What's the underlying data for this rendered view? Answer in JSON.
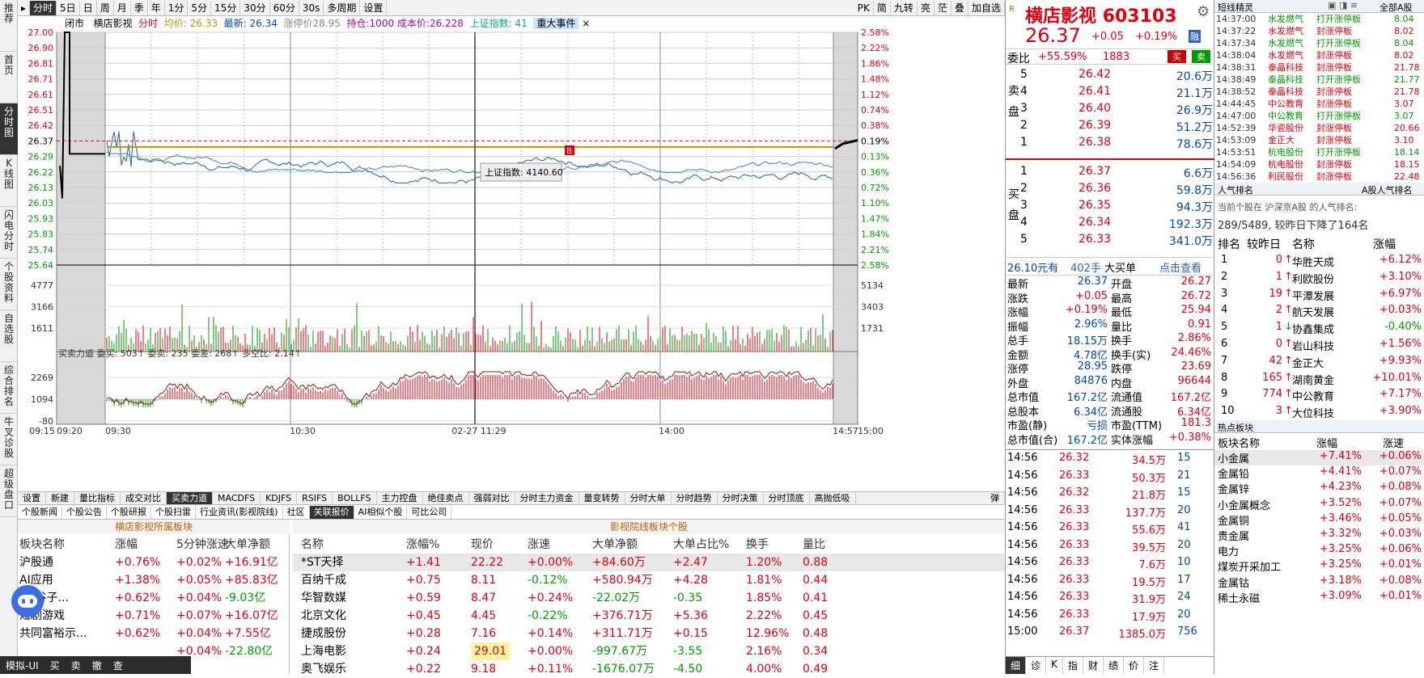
{
  "left_nav": [
    "推荐",
    "首页",
    "分时图",
    "K线图",
    "闪电分时",
    "个股资料",
    "自选股",
    "综合排名",
    "牛叉诊股",
    "超级盘口"
  ],
  "top_tabs": [
    "分时",
    "5日",
    "日",
    "周",
    "月",
    "季",
    "年",
    "1分",
    "5分",
    "15分",
    "30分",
    "60分",
    "30s",
    "多周期",
    "设置"
  ],
  "top_right_tabs": [
    "PK",
    "简",
    "九转",
    "亮",
    "茫",
    "叠",
    "加自选"
  ],
  "info_bar": {
    "status": "闭市",
    "name": "横店影视",
    "ftitle": "分时",
    "avg": "均价: 26.33",
    "latest": "最新: 26.34",
    "limitup": "涨停价28.95",
    "hold": "持仓:1000 成本价:26.228",
    "index": "上证指数: 41",
    "event": "重大事件"
  },
  "price_axis_left": [
    "27.00",
    "26.90",
    "26.81",
    "26.71",
    "26.61",
    "26.51",
    "26.42",
    "26.37",
    "26.29",
    "26.22",
    "26.13",
    "26.03",
    "25.93",
    "25.83",
    "25.74",
    "25.64"
  ],
  "pct_axis_right": [
    "2.58%",
    "2.22%",
    "1.86%",
    "1.48%",
    "1.12%",
    "0.74%",
    "0.38%",
    "0.19%",
    "0.13%",
    "0.36%",
    "0.72%",
    "1.10%",
    "1.47%",
    "1.84%",
    "2.21%",
    "2.58%"
  ],
  "vol_axis_left": [
    "4777",
    "3166",
    "1611"
  ],
  "vol_axis_right": [
    "5134",
    "3403",
    "1731"
  ],
  "ind_axis_left": [
    "2269",
    "1094",
    "-80"
  ],
  "ind_title": "买卖力道 委买: 503↑ 委卖: 235 委差: 268↑ 多空比: 2.14↑",
  "time_axis": [
    "09:15",
    "09:20",
    "09:30",
    "10:30",
    "02-27 11:29",
    "14:00",
    "14:57",
    "15:00"
  ],
  "tooltip": "上证指数: 4140.60",
  "toolbar2": [
    "设置",
    "新建",
    "量比指标",
    "成交对比",
    "买卖力道",
    "MACDFS",
    "KDJFS",
    "RSIFS",
    "BOLLFS",
    "主力控盘",
    "绝佳卖点",
    "强弱对比",
    "分时主力资金",
    "量变转势",
    "分时大单",
    "分时趋势",
    "分时决策",
    "分时顶底",
    "高抛低吸"
  ],
  "toolbar2_right": "弹",
  "tabs3": [
    "个股新闻",
    "个股公告",
    "个股研报",
    "个股扫雷",
    "行业资讯(影视院线)",
    "社区",
    "关联报价",
    "AI相似个股",
    "可比公司"
  ],
  "sector_panel": {
    "title": "横店影视所属板块",
    "headers": [
      "板块名称",
      "涨幅",
      "5分钟涨速",
      "大单净额"
    ],
    "rows": [
      [
        "沪股通",
        "+0.76%",
        "+0.02%",
        "+16.91亿"
      ],
      [
        "AI应用",
        "+1.38%",
        "+0.05%",
        "+85.83亿"
      ],
      [
        "济(谷子...",
        "+0.62%",
        "+0.04%",
        "-9.03亿"
      ],
      [
        "短剧游戏",
        "+0.71%",
        "+0.07%",
        "+16.07亿"
      ],
      [
        "共同富裕示...",
        "+0.62%",
        "+0.04%",
        "+7.55亿"
      ],
      [
        "",
        "",
        "+0.04%",
        "-22.80亿"
      ]
    ]
  },
  "stock_panel": {
    "title": "影视院线板块个股",
    "headers": [
      "名称",
      "涨幅%",
      "现价",
      "涨速",
      "大单净额",
      "大单占比%",
      "换手",
      "量比"
    ],
    "rows": [
      [
        "*ST天择",
        "+1.41",
        "22.22",
        "+0.00%",
        "+84.60万",
        "+2.47",
        "1.20%",
        "0.88"
      ],
      [
        "百纳千成",
        "+0.75",
        "8.11",
        "-0.12%",
        "+580.94万",
        "+4.28",
        "1.81%",
        "0.44"
      ],
      [
        "华智数媒",
        "+0.59",
        "8.47",
        "+0.24%",
        "-22.02万",
        "-0.35",
        "1.85%",
        "0.41"
      ],
      [
        "北京文化",
        "+0.45",
        "4.45",
        "-0.22%",
        "+376.71万",
        "+5.36",
        "2.22%",
        "0.45"
      ],
      [
        "捷成股份",
        "+0.28",
        "7.16",
        "+0.14%",
        "+311.71万",
        "+0.15",
        "12.96%",
        "0.48"
      ],
      [
        "上海电影",
        "+0.24",
        "29.01",
        "+0.00%",
        "-997.67万",
        "-3.55",
        "2.16%",
        "0.34"
      ],
      [
        "奥飞娱乐",
        "+0.22",
        "9.18",
        "+0.11%",
        "-1676.07万",
        "-4.50",
        "4.00%",
        "0.49"
      ]
    ]
  },
  "status_bar": [
    "模拟-UI",
    "买",
    "卖",
    "撤",
    "查"
  ],
  "quote": {
    "name": "横店影视",
    "code": "603103",
    "price": "26.37",
    "chg": "+0.05",
    "pct": "+0.19%",
    "badge": "融",
    "webi_label": "委比",
    "webi": "+55.59%",
    "webi_num": "1883",
    "buy": "买",
    "sell": "卖",
    "sell_label": "卖盘",
    "buy_label": "买盘",
    "asks": [
      [
        "5",
        "26.42",
        "20.6万"
      ],
      [
        "4",
        "26.41",
        "21.1万"
      ],
      [
        "3",
        "26.40",
        "26.9万"
      ],
      [
        "2",
        "26.39",
        "51.2万"
      ],
      [
        "1",
        "26.38",
        "78.6万"
      ]
    ],
    "bids": [
      [
        "1",
        "26.37",
        "6.6万"
      ],
      [
        "2",
        "26.36",
        "59.8万"
      ],
      [
        "3",
        "26.35",
        "94.3万"
      ],
      [
        "4",
        "26.34",
        "192.3万"
      ],
      [
        "5",
        "26.33",
        "341.0万"
      ]
    ],
    "bigorder": {
      "a": "26.10元有",
      "b": "402手",
      "c": "大买单",
      "d": "点击查看"
    },
    "stats": [
      [
        "最新",
        "26.37",
        "开盘",
        "26.27"
      ],
      [
        "涨跌",
        "+0.05",
        "最高",
        "26.72"
      ],
      [
        "涨幅",
        "+0.19%",
        "最低",
        "25.94"
      ],
      [
        "振幅",
        "2.96%",
        "量比",
        "0.91"
      ],
      [
        "总手",
        "18.15万",
        "换手",
        "2.86%"
      ],
      [
        "金额",
        "4.78亿",
        "换手(实)",
        "24.46%"
      ],
      [
        "涨停",
        "28.95",
        "跌停",
        "23.69"
      ],
      [
        "外盘",
        "84876",
        "内盘",
        "96644"
      ],
      [
        "总市值",
        "167.2亿",
        "流通值",
        "167.2亿"
      ],
      [
        "总股本",
        "6.34亿",
        "流通股",
        "6.34亿"
      ],
      [
        "市盈(静)",
        "亏损",
        "市盈(TTM)",
        "181.3"
      ],
      [
        "总市值(合)",
        "167.2亿",
        "实体涨幅",
        "+0.38%"
      ]
    ],
    "ticks": [
      [
        "14:56",
        "26.32",
        "34.5万",
        "15"
      ],
      [
        "14:56",
        "26.33",
        "50.3万",
        "21"
      ],
      [
        "14:56",
        "26.32",
        "21.8万",
        "15"
      ],
      [
        "14:56",
        "26.33",
        "137.7万",
        "20"
      ],
      [
        "14:56",
        "26.33",
        "55.6万",
        "41"
      ],
      [
        "14:56",
        "26.33",
        "39.5万",
        "20"
      ],
      [
        "14:56",
        "26.33",
        "7.6万",
        "10"
      ],
      [
        "14:56",
        "26.33",
        "19.5万",
        "17"
      ],
      [
        "14:56",
        "26.33",
        "31.9万",
        "24"
      ],
      [
        "14:56",
        "26.33",
        "17.9万",
        "20"
      ],
      [
        "15:00",
        "26.37",
        "1385.0万",
        "756"
      ]
    ],
    "bottom_tabs": [
      "细",
      "诊",
      "K",
      "指",
      "财",
      "绩",
      "价",
      "注"
    ]
  },
  "short_elves": {
    "title": "短线精灵",
    "filter": "全部A股",
    "rows": [
      [
        "14:37:00",
        "水发燃气",
        "打开涨停板",
        "8.04"
      ],
      [
        "14:37:22",
        "水发燃气",
        "封涨停板",
        "8.02"
      ],
      [
        "14:37:34",
        "水发燃气",
        "打开涨停板",
        "8.04"
      ],
      [
        "14:38:04",
        "水发燃气",
        "封涨停板",
        "8.02"
      ],
      [
        "14:38:31",
        "泰晶科技",
        "封涨停板",
        "21.78"
      ],
      [
        "14:38:49",
        "泰晶科技",
        "打开涨停板",
        "21.77"
      ],
      [
        "14:38:52",
        "泰晶科技",
        "封涨停板",
        "21.78"
      ],
      [
        "14:44:45",
        "中公教育",
        "封涨停板",
        "3.07"
      ],
      [
        "14:47:00",
        "中公教育",
        "打开涨停板",
        "3.07"
      ],
      [
        "14:52:39",
        "华瓷股份",
        "封涨停板",
        "20.66"
      ],
      [
        "14:53:09",
        "金正大",
        "封涨停板",
        "3.10"
      ],
      [
        "14:53:51",
        "杭电股份",
        "打开涨停板",
        "18.14"
      ],
      [
        "14:54:09",
        "杭电股份",
        "封涨停板",
        "18.15"
      ],
      [
        "14:56:36",
        "利民股份",
        "封涨停板",
        "22.48"
      ]
    ]
  },
  "popularity": {
    "title": "人气排名",
    "filter": "A股人气排名",
    "desc1": "当前个股在 沪深京A股 的人气排名:",
    "desc2": "289/5489, 较昨日下降了164名",
    "headers": [
      "排名",
      "较昨日",
      "名称",
      "涨幅"
    ],
    "rows": [
      [
        "1",
        "0",
        "华胜天成",
        "+6.12%"
      ],
      [
        "2",
        "1",
        "利欧股份",
        "+3.10%"
      ],
      [
        "3",
        "19",
        "平潭发展",
        "+6.97%"
      ],
      [
        "4",
        "2",
        "航天发展",
        "+0.03%"
      ],
      [
        "5",
        "1",
        "协鑫集成",
        "-0.40%"
      ],
      [
        "6",
        "0",
        "岩山科技",
        "+1.56%"
      ],
      [
        "7",
        "42",
        "金正大",
        "+9.93%"
      ],
      [
        "8",
        "165",
        "湖南黄金",
        "+10.01%"
      ],
      [
        "9",
        "774",
        "中公教育",
        "+7.17%"
      ],
      [
        "10",
        "3",
        "大位科技",
        "+3.90%"
      ]
    ]
  },
  "hot_sectors": {
    "title": "热点板块",
    "headers": [
      "板块名称",
      "涨幅",
      "涨速"
    ],
    "rows": [
      [
        "小金属",
        "+7.41%",
        "+0.06%"
      ],
      [
        "金属铅",
        "+4.41%",
        "+0.07%"
      ],
      [
        "金属锌",
        "+4.23%",
        "+0.08%"
      ],
      [
        "小金属概念",
        "+3.52%",
        "+0.07%"
      ],
      [
        "金属铜",
        "+3.46%",
        "+0.05%"
      ],
      [
        "贵金属",
        "+3.32%",
        "+0.03%"
      ],
      [
        "电力",
        "+3.25%",
        "+0.06%"
      ],
      [
        "煤炭开采加工",
        "+3.25%",
        "+0.01%"
      ],
      [
        "金属钴",
        "+3.18%",
        "+0.08%"
      ],
      [
        "稀土永磁",
        "+3.09%",
        "+0.01%"
      ]
    ]
  }
}
